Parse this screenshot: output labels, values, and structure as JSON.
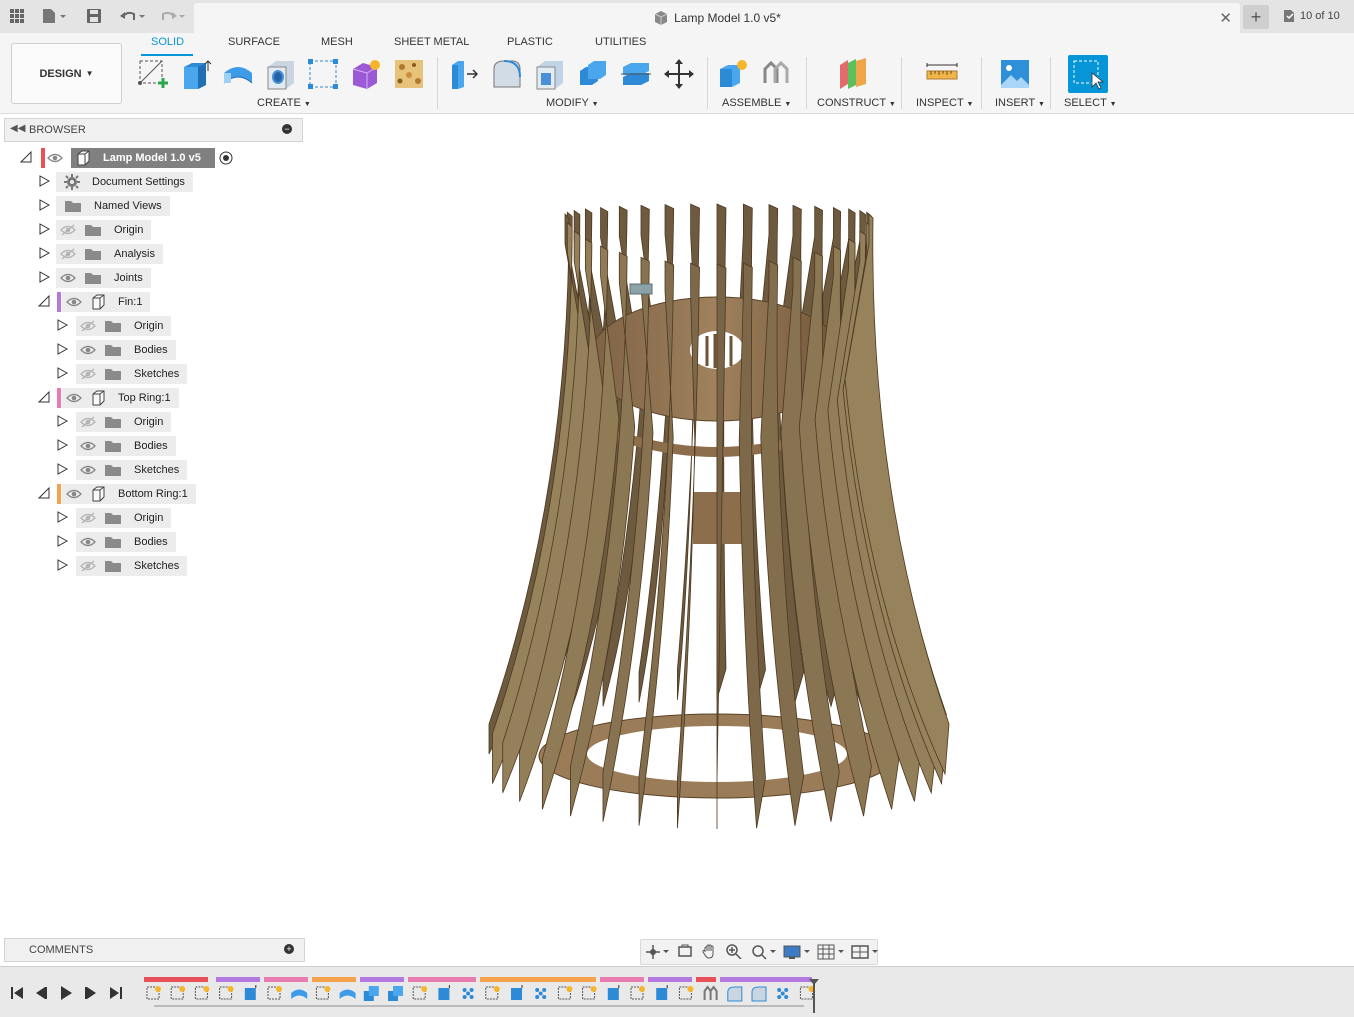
{
  "titlebar": {
    "document_title": "Lamp Model 1.0 v5*",
    "version_counter": "10 of 10",
    "icons": [
      "app-grid-icon",
      "file-icon",
      "save-icon",
      "undo-icon",
      "redo-icon",
      "close-icon",
      "plus-icon",
      "job-status-icon"
    ]
  },
  "toolbar": {
    "workspace": "DESIGN",
    "tabs": [
      "SOLID",
      "SURFACE",
      "MESH",
      "SHEET METAL",
      "PLASTIC",
      "UTILITIES"
    ],
    "active_tab": "SOLID",
    "groups": {
      "create": "CREATE",
      "modify": "MODIFY",
      "assemble": "ASSEMBLE",
      "construct": "CONSTRUCT",
      "inspect": "INSPECT",
      "insert": "INSERT",
      "select": "SELECT"
    },
    "accent": "#0696d7"
  },
  "browser": {
    "title": "BROWSER",
    "root": "Lamp Model 1.0 v5",
    "items": [
      {
        "label": "Document Settings"
      },
      {
        "label": "Named Views"
      },
      {
        "label": "Origin"
      },
      {
        "label": "Analysis"
      },
      {
        "label": "Joints"
      },
      {
        "label": "Fin:1"
      },
      {
        "label": "Origin"
      },
      {
        "label": "Bodies"
      },
      {
        "label": "Sketches"
      },
      {
        "label": "Top Ring:1"
      },
      {
        "label": "Origin"
      },
      {
        "label": "Bodies"
      },
      {
        "label": "Sketches"
      },
      {
        "label": "Bottom Ring:1"
      },
      {
        "label": "Origin"
      },
      {
        "label": "Bodies"
      },
      {
        "label": "Sketches"
      }
    ],
    "component_colors": {
      "root": "#e8515a",
      "fin": "#b377e0",
      "top_ring": "#e87bb0",
      "bottom_ring": "#f5a34b"
    }
  },
  "comments": {
    "title": "COMMENTS"
  },
  "timeline": {
    "controls": [
      "skip-to-start-icon",
      "step-back-icon",
      "play-icon",
      "step-forward-icon",
      "skip-to-end-icon"
    ]
  }
}
